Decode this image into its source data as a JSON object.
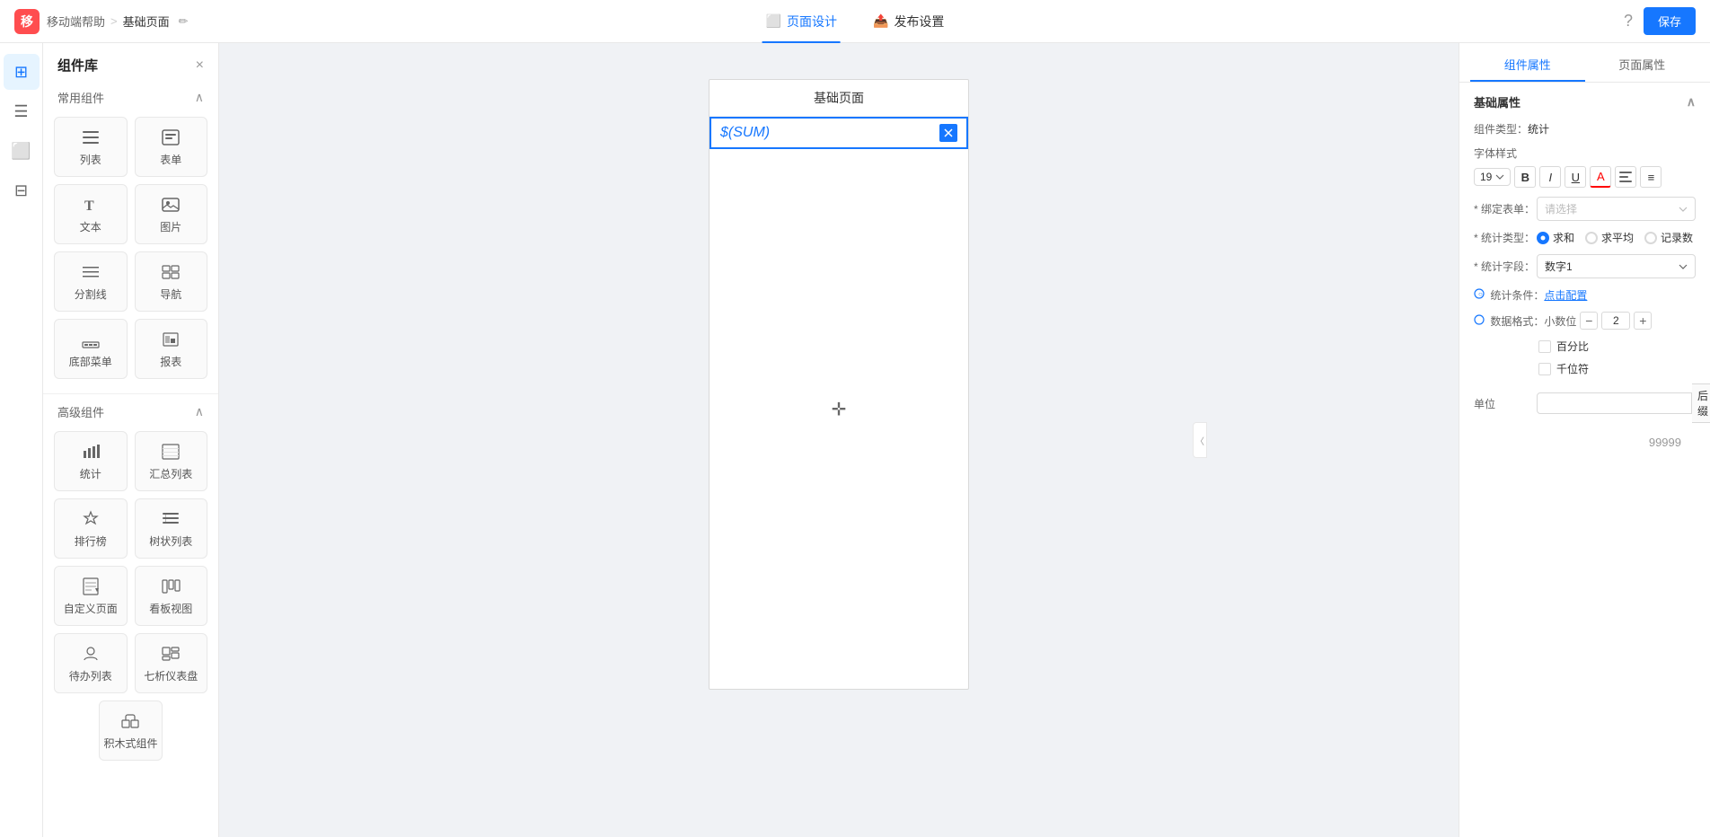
{
  "topbar": {
    "logo_text": "移",
    "app_name": "移动端帮助",
    "separator": ">",
    "page_name": "基础页面",
    "tab_design_label": "页面设计",
    "tab_publish_label": "发布设置",
    "help_icon": "?",
    "save_label": "保存"
  },
  "left_strip": {
    "icons": [
      "⊞",
      "☰",
      "⬜",
      "⊟"
    ]
  },
  "component_panel": {
    "title": "组件库",
    "close_icon": "×",
    "common_section": "常用组件",
    "components_common": [
      {
        "icon": "☰",
        "label": "列表"
      },
      {
        "icon": "📋",
        "label": "表单"
      },
      {
        "icon": "T",
        "label": "文本"
      },
      {
        "icon": "🖼",
        "label": "图片"
      },
      {
        "icon": "─",
        "label": "分割线"
      },
      {
        "icon": "⊞",
        "label": "导航"
      },
      {
        "icon": "📱",
        "label": "底部菜单"
      },
      {
        "icon": "📊",
        "label": "报表"
      }
    ],
    "advanced_section": "高级组件",
    "components_advanced": [
      {
        "icon": "📊",
        "label": "统计"
      },
      {
        "icon": "📋",
        "label": "汇总列表"
      },
      {
        "icon": "🏆",
        "label": "排行榜"
      },
      {
        "icon": "☰",
        "label": "树状列表"
      },
      {
        "icon": "📄",
        "label": "自定义页面"
      },
      {
        "icon": "📊",
        "label": "看板视图"
      },
      {
        "icon": "👥",
        "label": "待办列表"
      },
      {
        "icon": "📈",
        "label": "七析仪表盘"
      },
      {
        "icon": "🧱",
        "label": "积木式组件"
      }
    ]
  },
  "canvas": {
    "page_title": "基础页面",
    "sum_text": "$(SUM)",
    "delete_btn": "🗑"
  },
  "right_panel": {
    "tab_component": "组件属性",
    "tab_page": "页面属性",
    "section_basic": "基础属性",
    "prop_type_label": "组件类型：",
    "prop_type_value": "统计",
    "font_style_label": "字体样式",
    "font_size": "19",
    "font_bold": "B",
    "font_italic": "I",
    "font_underline": "U",
    "font_color": "A",
    "font_align": "≡",
    "required_mark": "*",
    "bind_form_label": "绑定表单：",
    "bind_form_placeholder": "请选择",
    "stat_type_label": "统计类型：",
    "stat_options": [
      "求和",
      "求平均",
      "记录数"
    ],
    "stat_field_label": "统计字段：",
    "stat_field_value": "数字1",
    "stat_condition_label": "统计条件：",
    "stat_condition_link": "点击配置",
    "data_format_label": "数据格式：",
    "decimal_label": "小数位",
    "decimal_minus": "−",
    "decimal_value": "2",
    "decimal_plus": "+",
    "percent_label": "百分比",
    "thousands_label": "千位符",
    "unit_label": "单位",
    "unit_suffix_placeholder": "",
    "unit_suffix_after": "后缀",
    "preview_value": "99999"
  }
}
